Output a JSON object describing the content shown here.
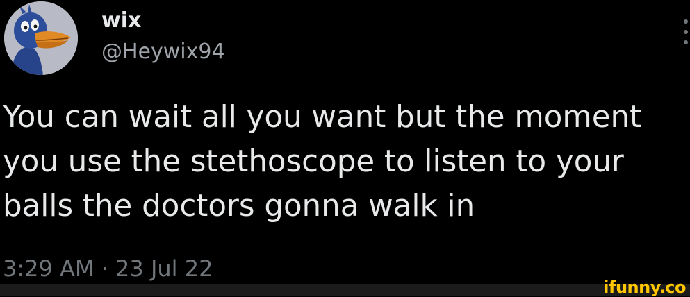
{
  "author": {
    "display_name": "wix",
    "handle": "@Heywix94",
    "avatar_icon": "cartoon-duck-avatar"
  },
  "tweet": {
    "text_lines": [
      "You can wait all you want but the moment",
      "you use the stethoscope to listen to your",
      "balls the doctors gonna walk in"
    ],
    "timestamp": "3:29 AM · 23 Jul 22"
  },
  "watermark": {
    "text": "ifunny.co"
  },
  "colors": {
    "background": "#000000",
    "primary_text": "#e7e9ea",
    "secondary_text": "#71767b",
    "watermark": "#ffc500"
  }
}
